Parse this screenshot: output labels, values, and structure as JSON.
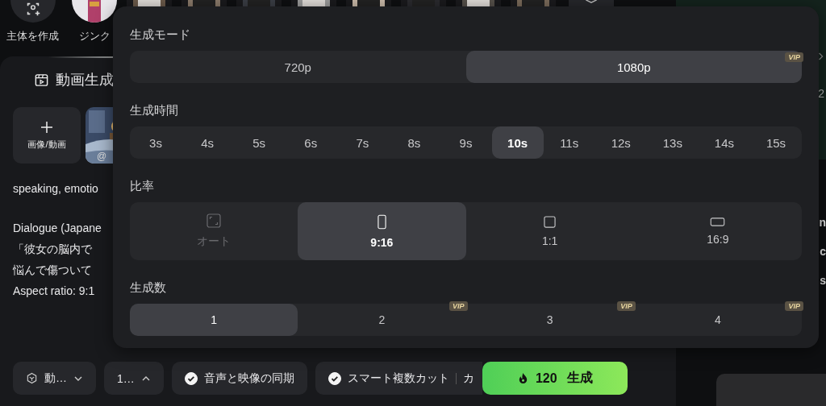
{
  "subjects": {
    "create_label": "主体を作成",
    "items": [
      {
        "label": "ジンク"
      }
    ]
  },
  "editor": {
    "title": "動画生成",
    "upload_label": "画像/動画",
    "reference_label": "@",
    "prompt_paragraphs": [
      [
        "speaking, emotio"
      ],
      [
        "Dialogue (Japane",
        "「彼女の脳内で",
        "悩んで傷ついて",
        "Aspect ratio: 9:1"
      ]
    ]
  },
  "toolbar": {
    "model": "動…",
    "settings": "1…",
    "sync": {
      "label": "音声と映像の同期",
      "checked": true
    },
    "smart_cut": {
      "label": "スマート複数カット",
      "checked": true,
      "extra": "カ"
    },
    "generate": {
      "cost": "120",
      "label": "生成"
    }
  },
  "side": {
    "fragments": [
      "2"
    ],
    "lower_fragments": [
      "n",
      "c",
      "s"
    ]
  },
  "popover": {
    "mode": {
      "title": "生成モード",
      "options": [
        {
          "label": "720p",
          "selected": false
        },
        {
          "label": "1080p",
          "selected": true,
          "badge": "VIP"
        }
      ]
    },
    "duration": {
      "title": "生成時間",
      "options": [
        {
          "label": "3s",
          "selected": false
        },
        {
          "label": "4s",
          "selected": false
        },
        {
          "label": "5s",
          "selected": false
        },
        {
          "label": "6s",
          "selected": false
        },
        {
          "label": "7s",
          "selected": false
        },
        {
          "label": "8s",
          "selected": false
        },
        {
          "label": "9s",
          "selected": false
        },
        {
          "label": "10s",
          "selected": true
        },
        {
          "label": "11s",
          "selected": false
        },
        {
          "label": "12s",
          "selected": false
        },
        {
          "label": "13s",
          "selected": false
        },
        {
          "label": "14s",
          "selected": false
        },
        {
          "label": "15s",
          "selected": false
        }
      ]
    },
    "ratio": {
      "title": "比率",
      "options": [
        {
          "label": "オート",
          "kind": "auto",
          "selected": false,
          "disabled": true
        },
        {
          "label": "9:16",
          "kind": "portrait",
          "selected": true,
          "disabled": false
        },
        {
          "label": "1:1",
          "kind": "square",
          "selected": false,
          "disabled": false
        },
        {
          "label": "16:9",
          "kind": "landscape",
          "selected": false,
          "disabled": false
        }
      ]
    },
    "count": {
      "title": "生成数",
      "options": [
        {
          "label": "1",
          "selected": true
        },
        {
          "label": "2",
          "selected": false,
          "badge": "VIP"
        },
        {
          "label": "3",
          "selected": false,
          "badge": "VIP"
        },
        {
          "label": "4",
          "selected": false,
          "badge": "VIP"
        }
      ]
    }
  }
}
